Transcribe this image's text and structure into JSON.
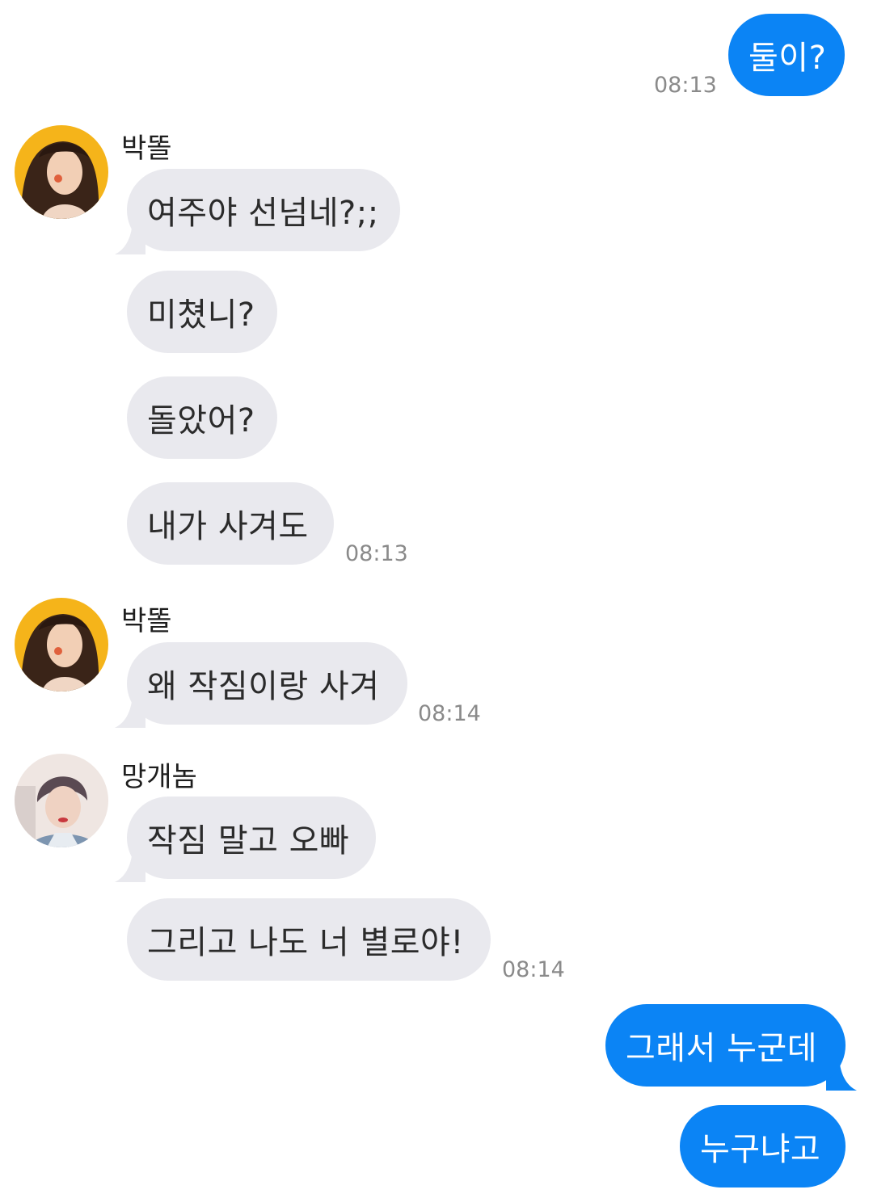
{
  "colors": {
    "outgoing_bubble": "#0b84f5",
    "incoming_bubble": "#e9e9ee",
    "timestamp": "#8a8a8a",
    "avatar_1_bg": "#f5b41a"
  },
  "messages": [
    {
      "direction": "outgoing",
      "text": "둘이?",
      "time": "08:13"
    },
    {
      "direction": "incoming",
      "sender": "박똘",
      "avatar_icon": "avatar-photo-woman-yellow-bg",
      "bubbles": [
        "여주야 선넘네?;;",
        "미쳤니?",
        "돌았어?",
        "내가 사겨도"
      ],
      "time": "08:13"
    },
    {
      "direction": "incoming",
      "sender": "박똘",
      "avatar_icon": "avatar-photo-woman-yellow-bg",
      "bubbles": [
        "왜 작짐이랑 사겨"
      ],
      "time": "08:14"
    },
    {
      "direction": "incoming",
      "sender": "망개놈",
      "avatar_icon": "avatar-photo-man",
      "bubbles": [
        "작짐 말고 오빠",
        "그리고 나도 너 별로야!"
      ],
      "time": "08:14"
    },
    {
      "direction": "outgoing",
      "bubbles": [
        "그래서 누군데",
        "누구냐고"
      ]
    }
  ]
}
